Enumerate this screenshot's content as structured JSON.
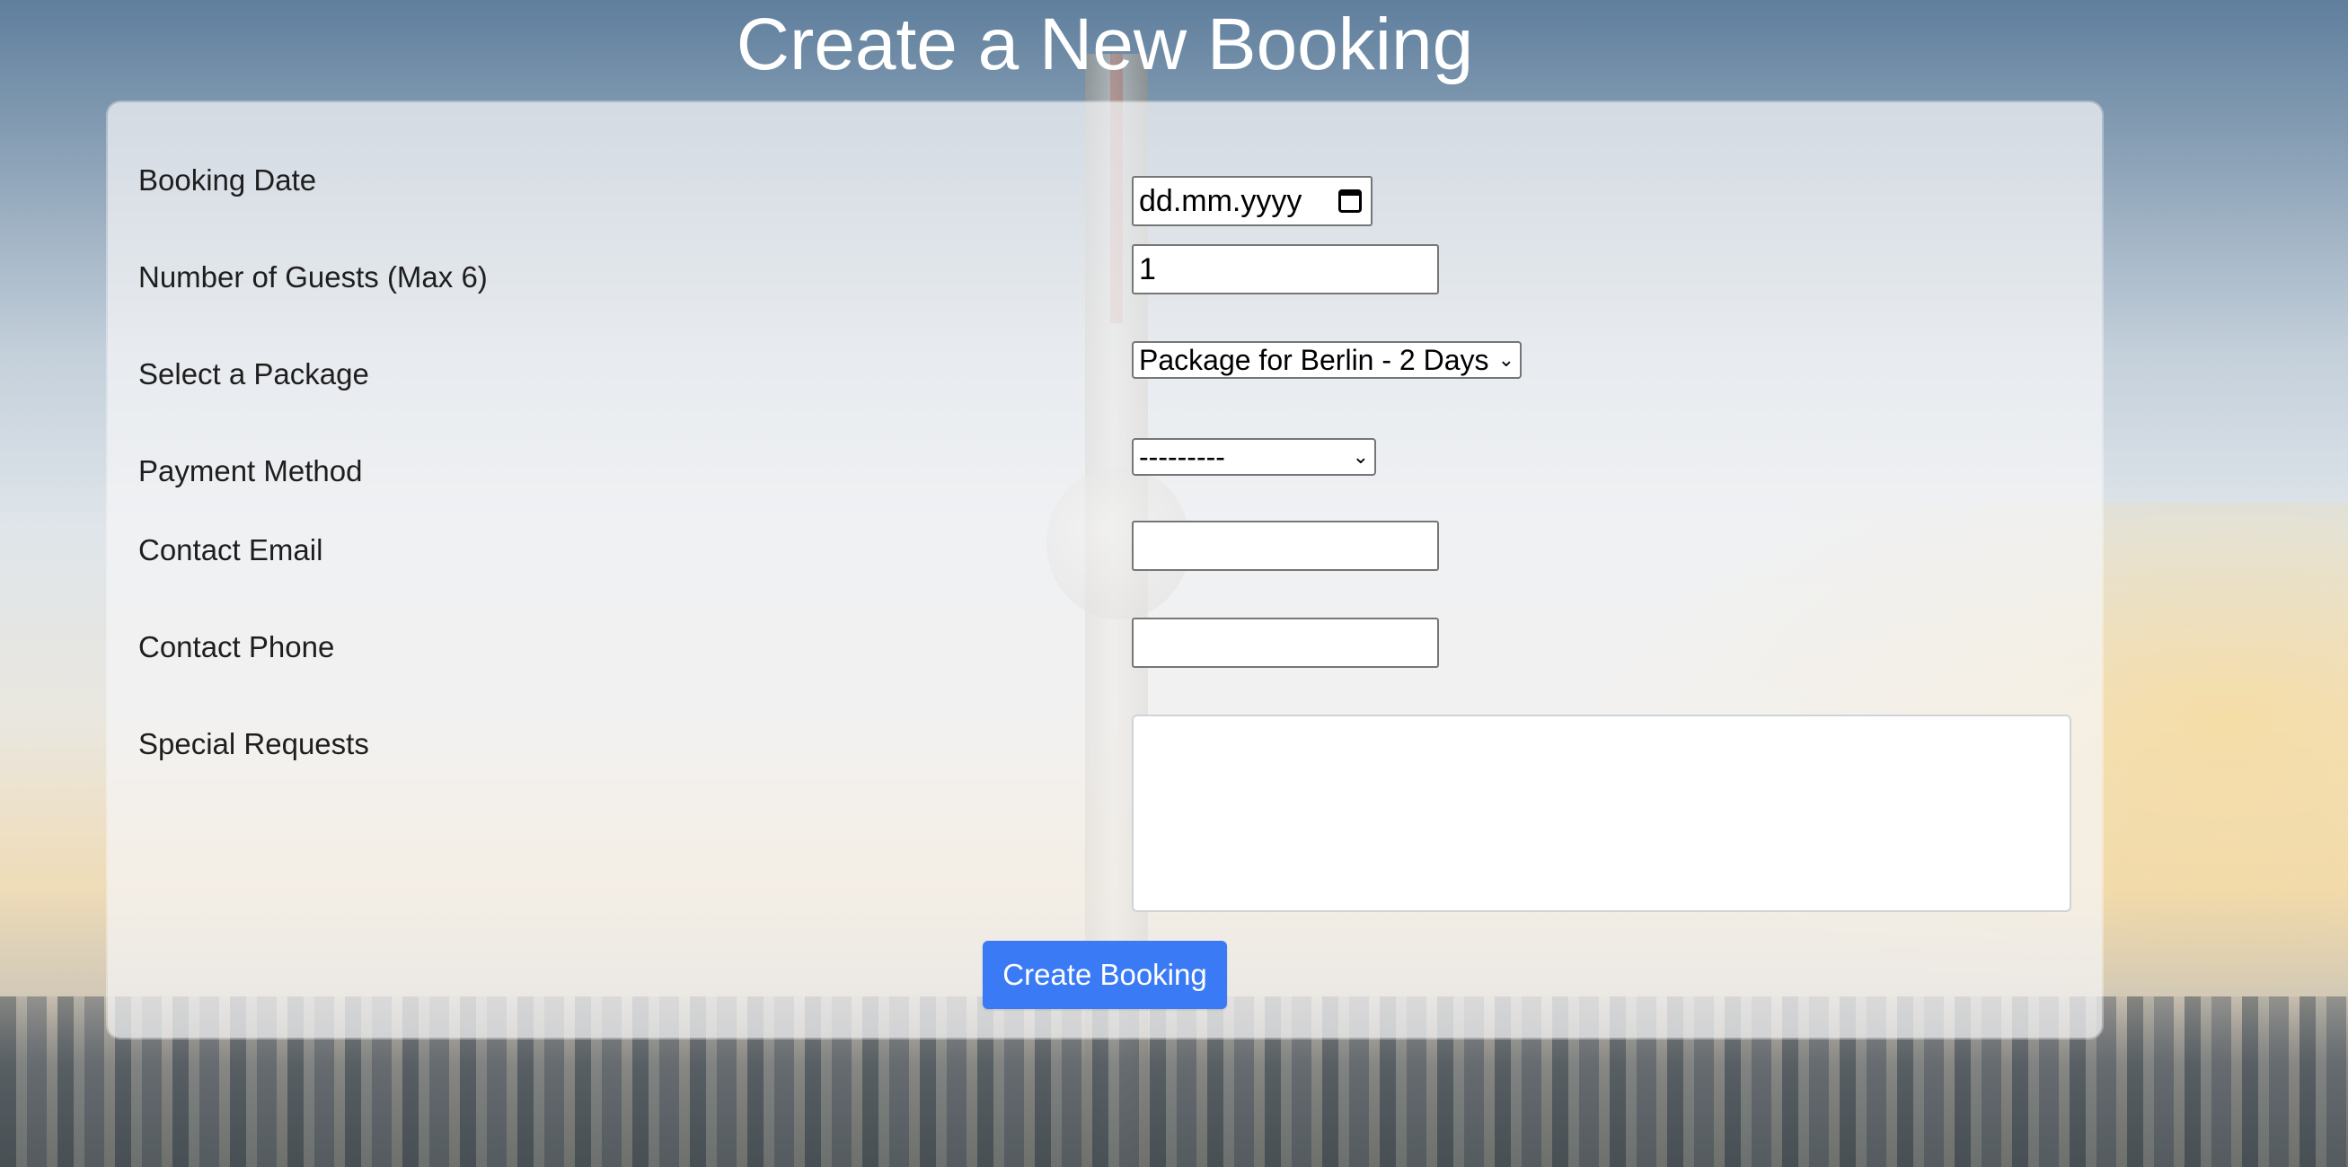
{
  "page": {
    "title": "Create a New Booking"
  },
  "form": {
    "booking_date": {
      "label": "Booking Date",
      "value": "dd.mm.yyyy"
    },
    "guests": {
      "label": "Number of Guests (Max 6)",
      "value": "1"
    },
    "package": {
      "label": "Select a Package",
      "selected": "Package for Berlin - 2 Days"
    },
    "payment": {
      "label": "Payment Method",
      "selected": "---------"
    },
    "email": {
      "label": "Contact Email",
      "value": ""
    },
    "phone": {
      "label": "Contact Phone",
      "value": ""
    },
    "requests": {
      "label": "Special Requests",
      "value": ""
    },
    "submit_label": "Create Booking"
  },
  "icons": {
    "date_picker": "calendar-icon",
    "select_arrow": "chevron-down-icon"
  },
  "colors": {
    "primary_button": "#3a7bf5",
    "title_text": "#ffffff"
  }
}
